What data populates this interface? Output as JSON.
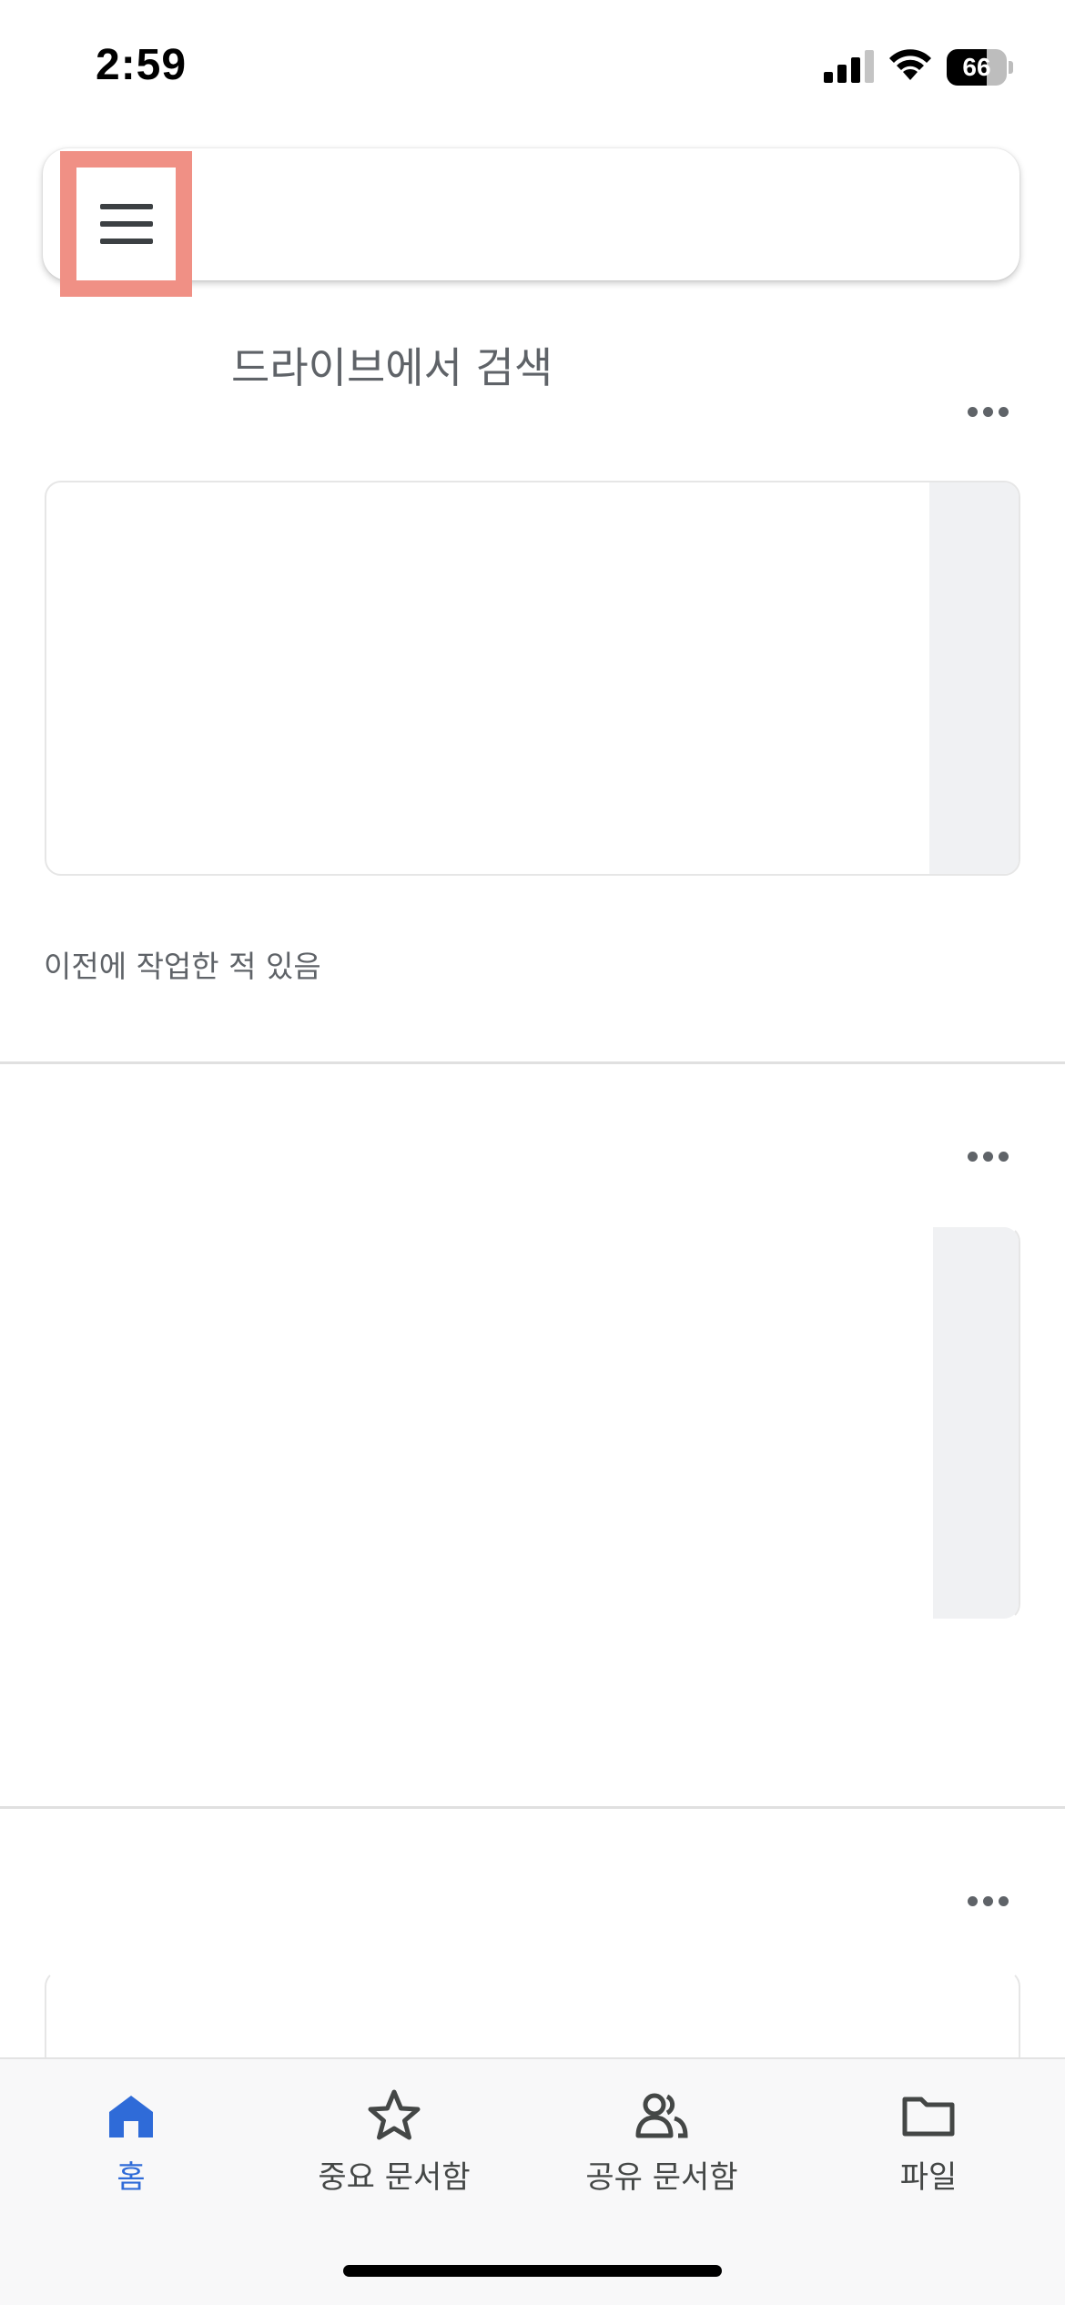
{
  "status_bar": {
    "time": "2:59",
    "battery_percent": "66",
    "battery_level": 0.66,
    "signal_bars": 3,
    "signal_total": 4
  },
  "search": {
    "placeholder": "드라이브에서 검색",
    "menu_icon": "hamburger-menu-icon"
  },
  "cards": [
    {
      "caption": "이전에 작업한 적 있음",
      "more_icon": "more-horizontal-icon"
    },
    {
      "caption": "",
      "more_icon": "more-horizontal-icon"
    },
    {
      "caption": "",
      "more_icon": "more-horizontal-icon"
    }
  ],
  "bottom_nav": {
    "items": [
      {
        "label": "홈",
        "icon": "home-icon",
        "active": true
      },
      {
        "label": "중요 문서함",
        "icon": "star-icon",
        "active": false
      },
      {
        "label": "공유 문서함",
        "icon": "people-icon",
        "active": false
      },
      {
        "label": "파일",
        "icon": "folder-icon",
        "active": false
      }
    ]
  },
  "colors": {
    "accent": "#2f6bd8",
    "highlight": "#f09085",
    "icon_gray": "#5f6368"
  }
}
